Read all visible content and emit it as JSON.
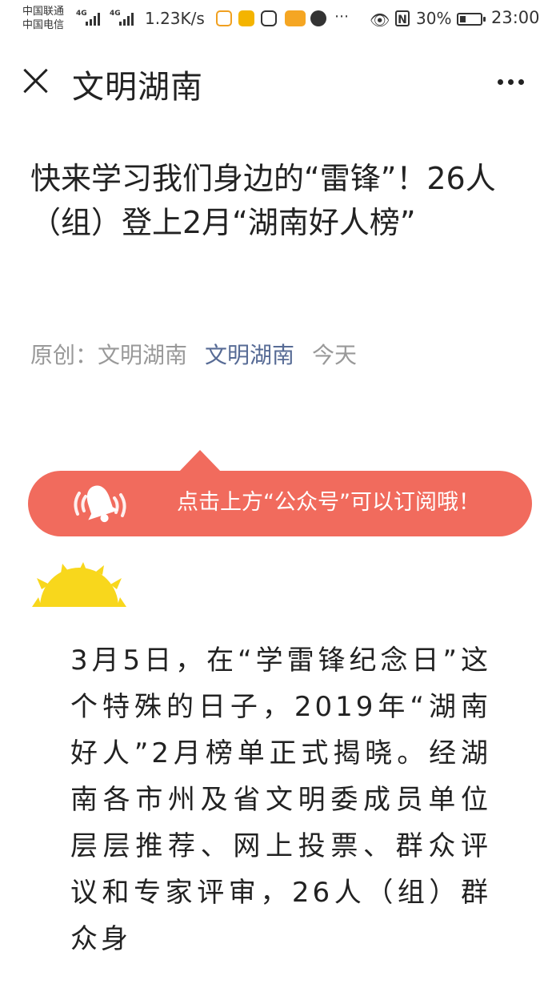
{
  "status_bar": {
    "carrier_1": "中国联通",
    "carrier_2": "中国电信",
    "net_1": "4G",
    "net_2": "4G",
    "speed": "1.23K/s",
    "battery_percent": "30%",
    "battery_level": 0.3,
    "time": "23:00"
  },
  "nav": {
    "title": "文明湖南"
  },
  "article": {
    "title": "快来学习我们身边的“雷锋”！26人（组）登上2月“湖南好人榜”",
    "meta_original": "原创：文明湖南",
    "meta_account": "文明湖南",
    "meta_date": "今天"
  },
  "banner": {
    "text": "点击上方“公众号”可以订阅哦！",
    "color": "#f16b5d"
  },
  "body_text": "3月5日，在“学雷锋纪念日”这个特殊的日子，2019年“湖南好人”2月榜单正式揭晓。经湖南各市州及省文明委成员单位层层推荐、网上投票、群众评议和专家评审，26人（组）群众身"
}
